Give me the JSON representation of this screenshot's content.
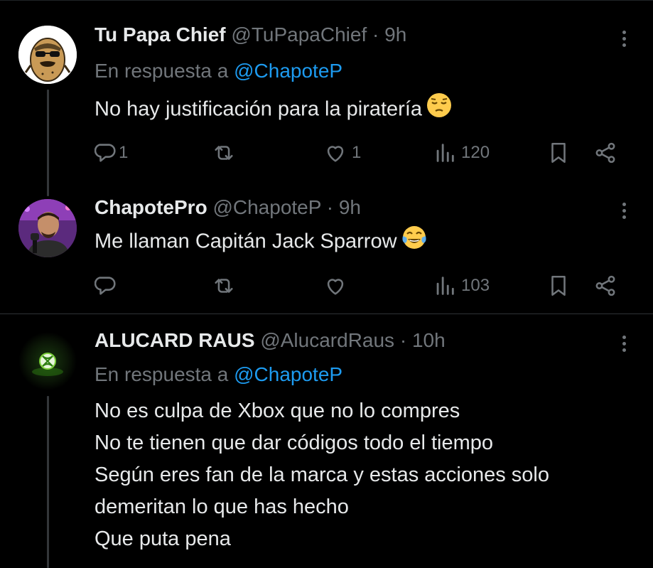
{
  "tweets": [
    {
      "display_name": "Tu Papa Chief",
      "handle": "@TuPapaChief",
      "separator": "·",
      "time": "9h",
      "reply_prefix": "En respuesta a",
      "reply_to": "@ChapoteP",
      "text": "No hay justificación para la piratería",
      "emoji": "pensive-face",
      "replies": "1",
      "retweets": "",
      "likes": "1",
      "views": "120"
    },
    {
      "display_name": "ChapotePro",
      "handle": "@ChapoteP",
      "separator": "·",
      "time": "9h",
      "text": "Me llaman Capitán Jack Sparrow",
      "emoji": "face-with-tears-of-joy",
      "replies": "",
      "retweets": "",
      "likes": "",
      "views": "103"
    },
    {
      "display_name": "ALUCARD RAUS",
      "handle": "@AlucardRaus",
      "separator": "·",
      "time": "10h",
      "reply_prefix": "En respuesta a",
      "reply_to": "@ChapoteP",
      "lines": [
        "No es culpa de Xbox que no lo compres",
        "No te tienen que dar códigos todo el tiempo",
        "Según eres fan de la marca y estas acciones solo",
        "demeritan lo que has hecho",
        "Que puta pena"
      ]
    }
  ],
  "colors": {
    "background": "#000000",
    "text": "#e7e9ea",
    "muted": "#71767b",
    "link": "#1d9bf0",
    "divider": "#2f3336"
  }
}
